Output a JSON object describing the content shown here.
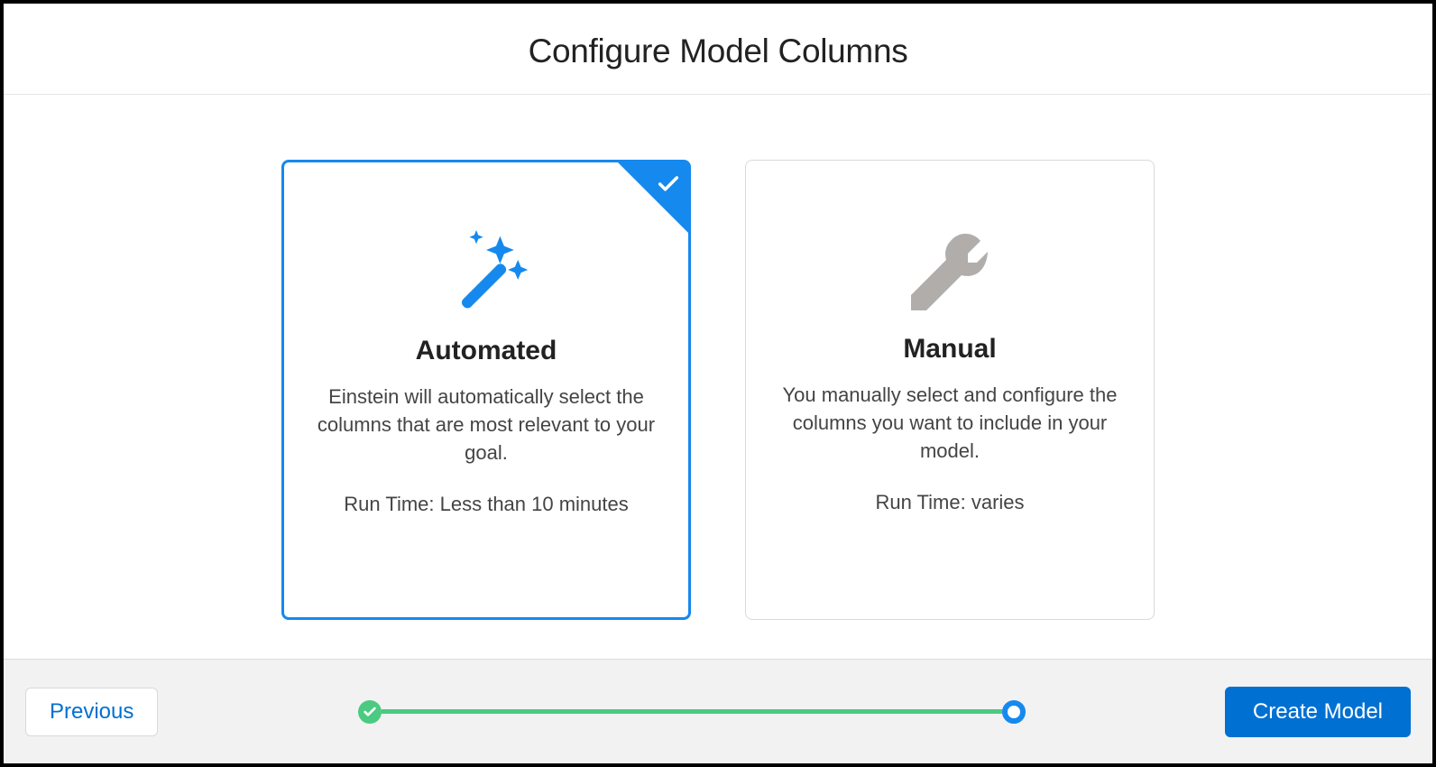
{
  "header": {
    "title": "Configure Model Columns"
  },
  "options": {
    "automated": {
      "title": "Automated",
      "description": "Einstein will automatically select the columns that are most relevant to your goal.",
      "runtime": "Run Time: Less than 10 minutes",
      "selected": true
    },
    "manual": {
      "title": "Manual",
      "description": "You manually select and configure the columns you want to include in your model.",
      "runtime": "Run Time: varies",
      "selected": false
    }
  },
  "footer": {
    "previous_label": "Previous",
    "create_label": "Create Model"
  },
  "colors": {
    "primary_blue": "#1589ee",
    "button_blue": "#0070d2",
    "success_green": "#4bca81",
    "icon_grey": "#b0adab"
  }
}
